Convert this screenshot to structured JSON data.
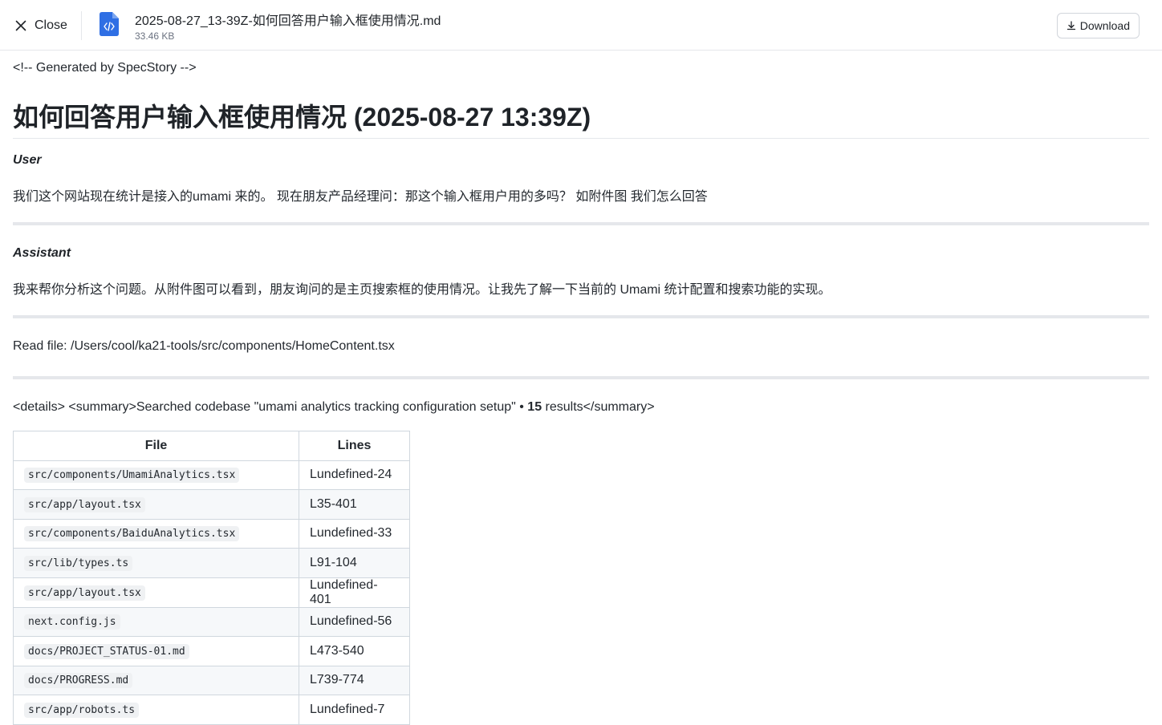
{
  "topbar": {
    "close_label": "Close",
    "file_name": "2025-08-27_13-39Z-如何回答用户输入框使用情况.md",
    "file_size": "33.46 KB",
    "download_label": "Download",
    "file_icon": "code-file-icon",
    "accent_color": "#2f6fe4"
  },
  "doc": {
    "comment": "<!-- Generated by SpecStory -->",
    "title": "如何回答用户输入框使用情况 (2025-08-27 13:39Z)",
    "user_role": "User",
    "user_message": "我们这个网站现在统计是接入的umami 来的。 现在朋友产品经理问：那这个输入框用户用的多吗？ 如附件图 我们怎么回答",
    "assistant_role": "Assistant",
    "assistant_message": "我来帮你分析这个问题。从附件图可以看到，朋友询问的是主页搜索框的使用情况。让我先了解一下当前的 Umami 统计配置和搜索功能的实现。",
    "read_file": "Read file: /Users/cool/ka21-tools/src/components/HomeContent.tsx",
    "search_prefix": "<details> <summary>Searched codebase \"umami analytics tracking configuration setup\" • ",
    "search_count": "15",
    "search_suffix": " results</summary>"
  },
  "table": {
    "headers": [
      "File",
      "Lines"
    ],
    "rows": [
      {
        "file": "src/components/UmamiAnalytics.tsx",
        "lines": "Lundefined-24"
      },
      {
        "file": "src/app/layout.tsx",
        "lines": "L35-401"
      },
      {
        "file": "src/components/BaiduAnalytics.tsx",
        "lines": "Lundefined-33"
      },
      {
        "file": "src/lib/types.ts",
        "lines": "L91-104"
      },
      {
        "file": "src/app/layout.tsx",
        "lines": "Lundefined-401"
      },
      {
        "file": "next.config.js",
        "lines": "Lundefined-56"
      },
      {
        "file": "docs/PROJECT_STATUS-01.md",
        "lines": "L473-540"
      },
      {
        "file": "docs/PROGRESS.md",
        "lines": "L739-774"
      },
      {
        "file": "src/app/robots.ts",
        "lines": "Lundefined-7"
      }
    ]
  }
}
